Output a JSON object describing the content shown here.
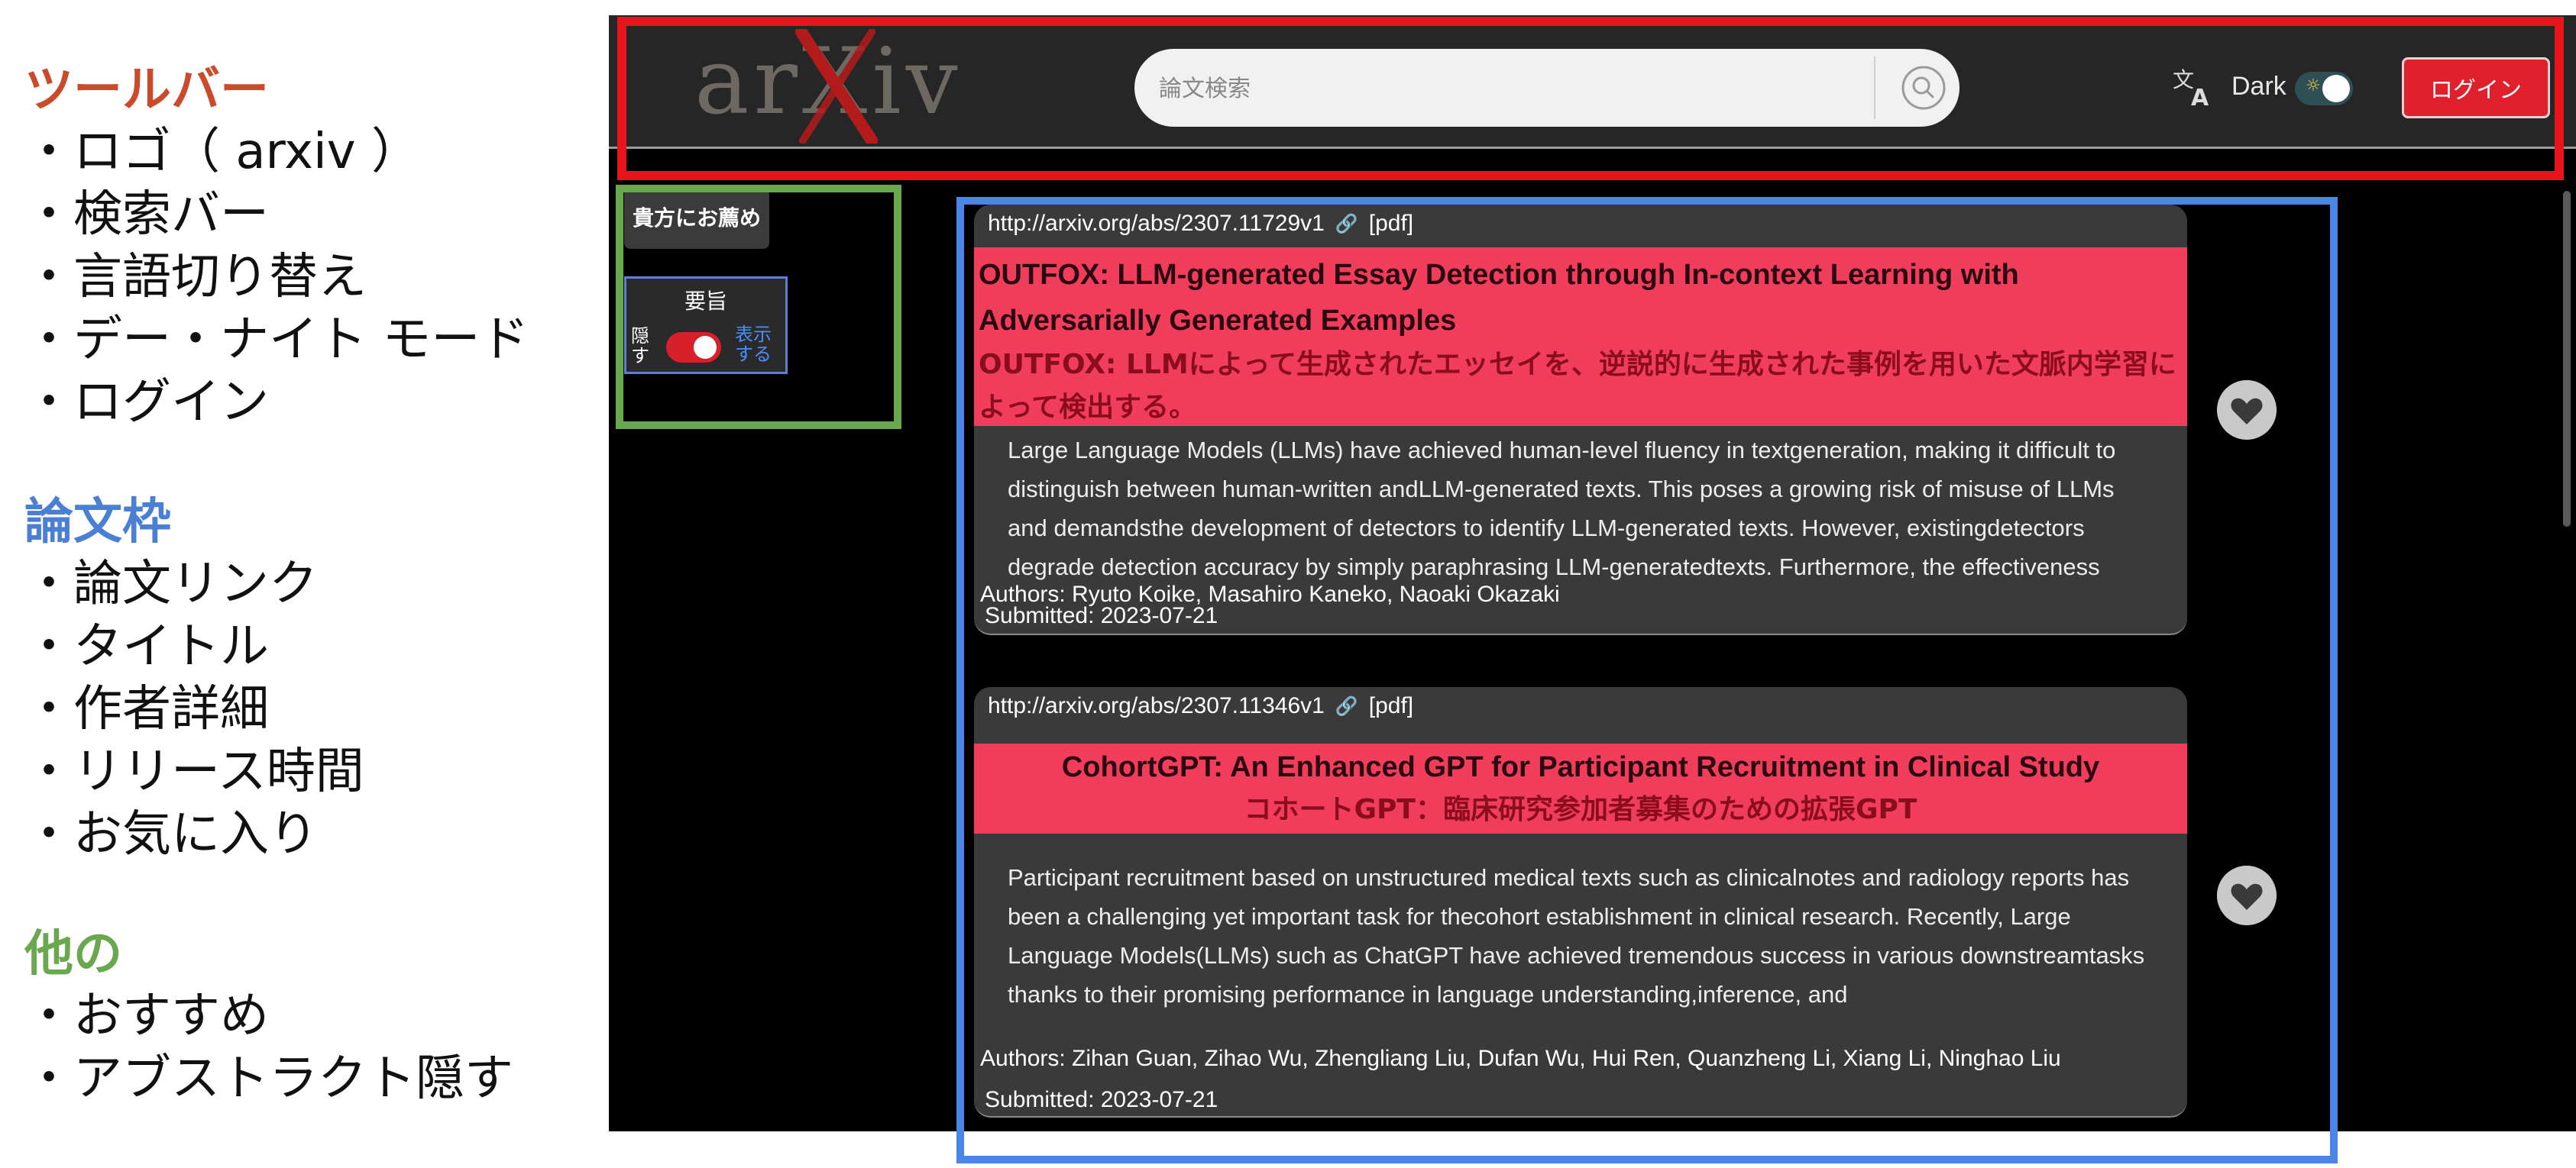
{
  "legend": {
    "toolbar": {
      "title": "ツールバー",
      "color": "#cc4a2c",
      "items": [
        "・ロゴ（ arxiv ）",
        "・検索バー",
        "・言語切り替え",
        "・デー・ナイト モード",
        "・ログイン"
      ]
    },
    "paper_frame": {
      "title": "論文枠",
      "color": "#4a7fd4",
      "items": [
        "・論文リンク",
        "・タイトル",
        "・作者詳細",
        "・リリース時間",
        "・お気に入り"
      ]
    },
    "other": {
      "title": "他の",
      "color": "#6aa84f",
      "items": [
        "・おすすめ",
        "・アブストラクト隠す"
      ]
    }
  },
  "header": {
    "logo_text": "arXiv",
    "search_placeholder": "論文検索",
    "dark_label": "Dark",
    "login_label": "ログイン"
  },
  "sidebar": {
    "recommend_label": "貴方にお薦め",
    "abstract_title": "要旨",
    "hide_label": "隠す",
    "show_label": "表示する",
    "abstract_visible": true
  },
  "papers": [
    {
      "link": "http://arxiv.org/abs/2307.11729v1",
      "pdf_label": "[pdf]",
      "title_en": "OUTFOX: LLM-generated Essay Detection through In-context Learning with Adversarially Generated Examples",
      "title_ja": "OUTFOX: LLMによって生成されたエッセイを、逆説的に生成された事例を用いた文脈内学習によって検出する。",
      "abstract": "Large Language Models (LLMs) have achieved human-level fluency in textgeneration, making it difficult to distinguish between human-written andLLM-generated texts. This poses a growing risk of misuse of LLMs and demandsthe development of detectors to identify LLM-generated texts. However, existingdetectors degrade detection accuracy by simply paraphrasing LLM-generatedtexts. Furthermore, the effectiveness",
      "authors": "Authors:   Ryuto Koike, Masahiro Kaneko, Naoaki Okazaki",
      "submitted": "Submitted:   2023-07-21"
    },
    {
      "link": "http://arxiv.org/abs/2307.11346v1",
      "pdf_label": "[pdf]",
      "title_en": "CohortGPT: An Enhanced GPT for Participant Recruitment in Clinical Study",
      "title_ja": "コホートGPT：臨床研究参加者募集のための拡張GPT",
      "abstract": "Participant recruitment based on unstructured medical texts such as clinicalnotes and radiology reports has been a challenging yet important task for thecohort establishment in clinical research. Recently, Large Language Models(LLMs) such as ChatGPT have achieved tremendous success in various downstreamtasks thanks to their promising performance in language understanding,inference, and",
      "authors": "Authors:   Zihan Guan, Zihao Wu, Zhengliang Liu, Dufan Wu, Hui Ren, Quanzheng Li, Xiang Li, Ninghao Liu",
      "submitted": "Submitted:   2023-07-21"
    }
  ],
  "colors": {
    "toolbar_frame": "#e8141c",
    "paper_frame": "#4a86e8",
    "other_frame": "#6aa84f",
    "title_band": "#f13d5c",
    "accent_red": "#e0202c"
  }
}
